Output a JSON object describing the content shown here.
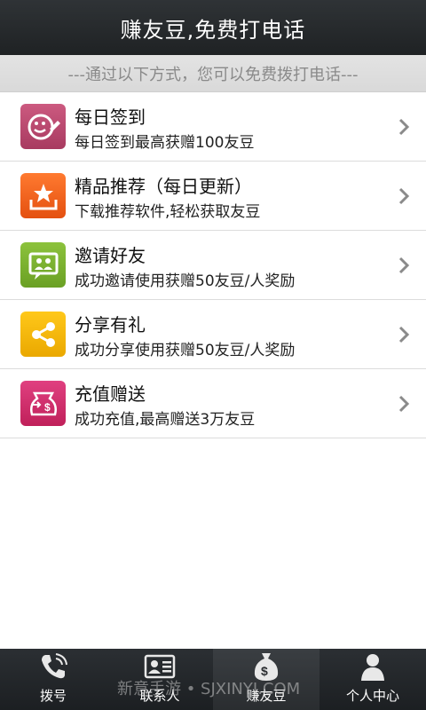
{
  "header": {
    "title": "赚友豆,免费打电话"
  },
  "subheader": {
    "text": "---通过以下方式，您可以免费拨打电话---"
  },
  "items": [
    {
      "title": "每日签到",
      "desc": "每日签到最高获赠100友豆",
      "icon": "checkin-icon",
      "color": "#c04870"
    },
    {
      "title": "精品推荐（每日更新）",
      "desc": "下载推荐软件,轻松获取友豆",
      "icon": "download-star-icon",
      "color": "#f06020"
    },
    {
      "title": "邀请好友",
      "desc": "成功邀请使用获赠50友豆/人奖励",
      "icon": "invite-friends-icon",
      "color": "#7ab030"
    },
    {
      "title": "分享有礼",
      "desc": "成功分享使用获赠50友豆/人奖励",
      "icon": "share-icon",
      "color": "#f0b800"
    },
    {
      "title": "充值赠送",
      "desc": "成功充值,最高赠送3万友豆",
      "icon": "recharge-icon",
      "color": "#d0306a"
    }
  ],
  "tabs": [
    {
      "label": "拨号",
      "icon": "phone-icon"
    },
    {
      "label": "联系人",
      "icon": "contact-card-icon"
    },
    {
      "label": "赚友豆",
      "icon": "money-bag-icon",
      "active": true
    },
    {
      "label": "个人中心",
      "icon": "person-icon"
    }
  ],
  "watermark": "新意手游 • SJXINYI.COM"
}
